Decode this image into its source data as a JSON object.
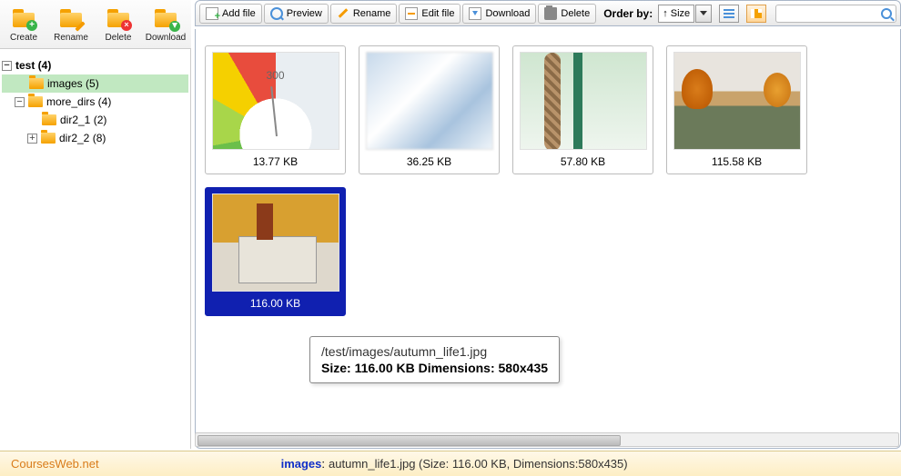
{
  "top_toolbar": {
    "create": "Create",
    "rename": "Rename",
    "delete": "Delete",
    "download": "Download"
  },
  "action_bar": {
    "add_file": "Add file",
    "preview": "Preview",
    "rename": "Rename",
    "edit_file": "Edit file",
    "download": "Download",
    "delete": "Delete",
    "order_by_label": "Order by:",
    "order_by_value": "↑ Size"
  },
  "search": {
    "placeholder": ""
  },
  "tree": {
    "root": {
      "label": "test (4)",
      "toggle": "−"
    },
    "images": {
      "label": "images (5)"
    },
    "more_dirs": {
      "label": "more_dirs (4)",
      "toggle": "−"
    },
    "dir2_1": {
      "label": "dir2_1 (2)"
    },
    "dir2_2": {
      "label": "dir2_2 (8)",
      "toggle": "+"
    }
  },
  "thumbs": [
    {
      "size": "13.77 KB"
    },
    {
      "size": "36.25 KB"
    },
    {
      "size": "57.80 KB"
    },
    {
      "size": "115.58 KB"
    },
    {
      "size": "116.00 KB"
    }
  ],
  "tooltip": {
    "path": "/test/images/autumn_life1.jpg",
    "details": "Size: 116.00 KB Dimensions: 580x435"
  },
  "status": {
    "brand": "CoursesWeb.net",
    "folder": "images",
    "sep": " : ",
    "info": "autumn_life1.jpg (Size: 116.00 KB, Dimensions:580x435)"
  }
}
